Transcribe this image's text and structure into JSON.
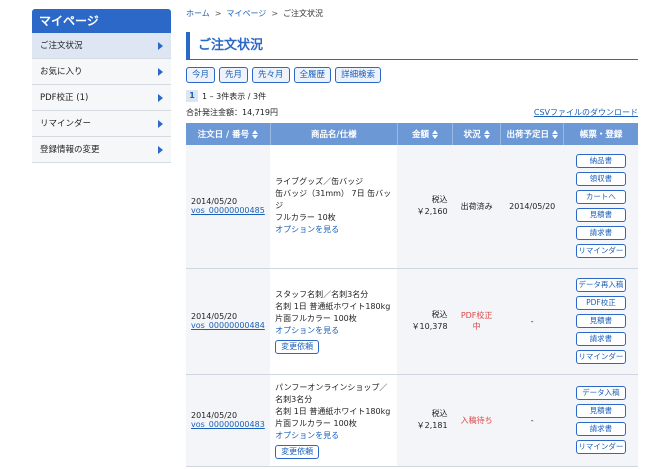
{
  "sidebar": {
    "title": "マイページ",
    "items": [
      {
        "label": "ご注文状況"
      },
      {
        "label": "お気に入り"
      },
      {
        "label": "PDF校正 (1)"
      },
      {
        "label": "リマインダー"
      },
      {
        "label": "登録情報の変更"
      }
    ]
  },
  "breadcrumb": {
    "home": "ホーム",
    "mypage": "マイページ",
    "current": "ご注文状況",
    "sep": ">"
  },
  "page_title": "ご注文状況",
  "filters": [
    "今月",
    "先月",
    "先々月",
    "全履歴",
    "詳細検索"
  ],
  "pager": {
    "page": "1",
    "text": "1 – 3件表示 / 3件"
  },
  "summary": {
    "total": "合計発注金額：14,719円",
    "csv": "CSVファイルのダウンロード"
  },
  "table": {
    "headers": {
      "date": "注文日 / 番号",
      "product": "商品名/仕様",
      "amount": "金額",
      "status": "状況",
      "ship": "出荷予定日",
      "actions": "帳票・登録"
    },
    "rows": [
      {
        "date": "2014/05/20",
        "order_no": "vos_00000000485",
        "product_lines": [
          "ライブグッズ／缶バッジ",
          "缶バッジ（31mm） 7日 缶バッジ",
          "フルカラー 10枚"
        ],
        "option": "オプションを見る",
        "tax": "税込",
        "price": "￥2,160",
        "status": "出荷済み",
        "ship": "2014/05/20",
        "actions": [
          "納品書",
          "領収書",
          "カートへ",
          "見積書",
          "請求書",
          "リマインダー"
        ]
      },
      {
        "date": "2014/05/20",
        "order_no": "vos_00000000484",
        "product_lines": [
          "スタッフ名刺／名刺3名分",
          "名刺 1日 普通紙ホワイト180kg",
          "片面フルカラー 100枚"
        ],
        "option": "オプションを見る",
        "change": "変更依頼",
        "tax": "税込",
        "price": "￥10,378",
        "status": "PDF校正中",
        "ship": "-",
        "actions": [
          "データ再入稿",
          "PDF校正",
          "見積書",
          "請求書",
          "リマインダー"
        ]
      },
      {
        "date": "2014/05/20",
        "order_no": "vos_00000000483",
        "product_lines": [
          "パンフーオンラインショップ／",
          "名刺3名分",
          "名刺 1日 普通紙ホワイト180kg",
          "片面フルカラー 100枚"
        ],
        "option": "オプションを見る",
        "change": "変更依頼",
        "tax": "税込",
        "price": "￥2,181",
        "status": "入稿待ち",
        "ship": "-",
        "actions": [
          "データ入稿",
          "見積書",
          "請求書",
          "リマインダー"
        ]
      }
    ]
  },
  "colors": {
    "accent": "#2b68c8",
    "header": "#6c98d6",
    "alert": "#e14545"
  }
}
